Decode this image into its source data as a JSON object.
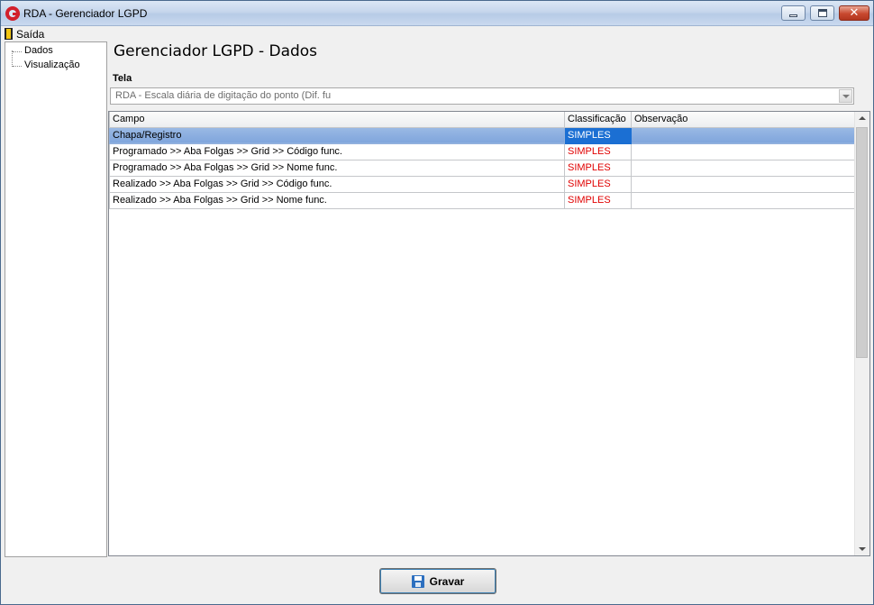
{
  "window": {
    "title": "RDA - Gerenciador LGPD",
    "close_glyph": "✕"
  },
  "menu": {
    "items": [
      {
        "label": "Saída",
        "icon": "door-exit-icon"
      }
    ]
  },
  "tree": {
    "items": [
      {
        "label": "Dados"
      },
      {
        "label": "Visualização"
      }
    ]
  },
  "main": {
    "title": "Gerenciador LGPD - Dados",
    "tela_label": "Tela",
    "tela_value": "RDA - Escala diária de digitação do ponto (Dif. fu"
  },
  "grid": {
    "columns": [
      "Campo",
      "Classificação",
      "Observação"
    ],
    "rows": [
      {
        "campo": "Chapa/Registro",
        "classificacao": "SIMPLES",
        "observacao": ""
      },
      {
        "campo": "Programado >> Aba Folgas >> Grid >> Código func.",
        "classificacao": "SIMPLES",
        "observacao": ""
      },
      {
        "campo": "Programado >> Aba Folgas >> Grid >> Nome func.",
        "classificacao": "SIMPLES",
        "observacao": ""
      },
      {
        "campo": "Realizado >> Aba Folgas >> Grid >> Código func.",
        "classificacao": "SIMPLES",
        "observacao": ""
      },
      {
        "campo": "Realizado >> Aba Folgas >> Grid >> Nome func.",
        "classificacao": "SIMPLES",
        "observacao": ""
      }
    ],
    "selected_row": 0
  },
  "actions": {
    "save_label": "Gravar"
  },
  "colors": {
    "classification_text": "#e00000",
    "selection": "#1b6fd3",
    "accent": "#2c6fbf"
  }
}
